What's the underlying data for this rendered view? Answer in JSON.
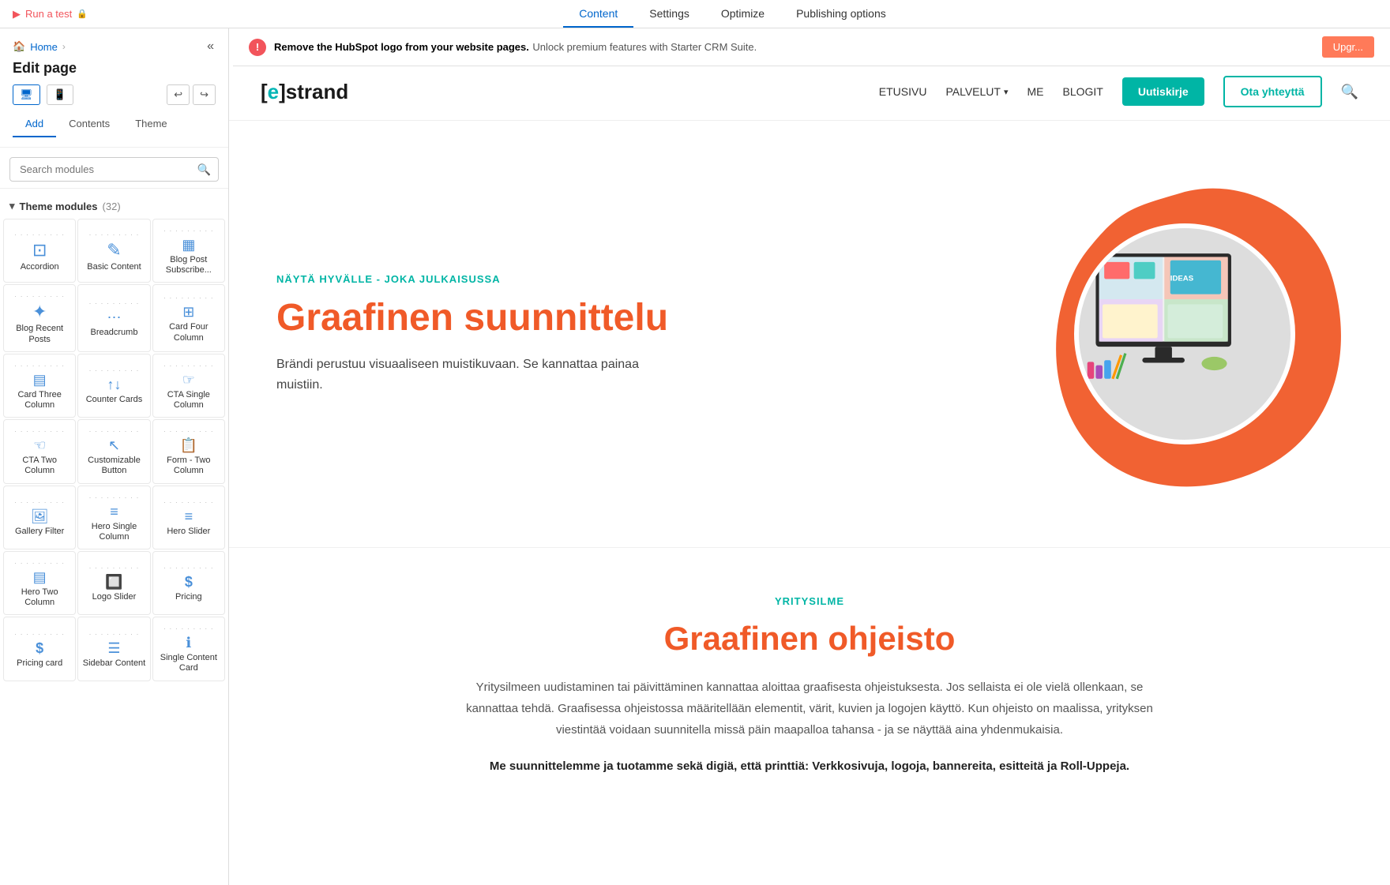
{
  "topBar": {
    "runTest": "Run a test",
    "tabs": [
      "Content",
      "Settings",
      "Optimize",
      "Publishing options"
    ],
    "activeTab": "Content"
  },
  "notification": {
    "text": "Remove the HubSpot logo from your website pages.",
    "subtext": "Unlock premium features with Starter CRM Suite.",
    "upgradeLabel": "Upgr..."
  },
  "leftPanel": {
    "collapseIcon": "«",
    "breadcrumb": "Home",
    "pageTitle": "Edit page",
    "deviceIcons": [
      "desktop",
      "mobile"
    ],
    "undoRedo": [
      "undo",
      "redo"
    ],
    "tabs": [
      "Add",
      "Contents",
      "Theme"
    ],
    "activeTab": "Add",
    "search": {
      "placeholder": "Search modules",
      "icon": "🔍"
    },
    "themeBadge": "Theme",
    "sectionLabel": "Theme modules",
    "moduleCount": "32",
    "modules": [
      {
        "name": "Accordion",
        "icon": "⊡",
        "dots": "........."
      },
      {
        "name": "Basic Content",
        "icon": "✎",
        "dots": "........."
      },
      {
        "name": "Blog Post Subscribe...",
        "icon": "▦",
        "dots": "........."
      },
      {
        "name": "Blog Recent Posts",
        "icon": "✦",
        "dots": "........."
      },
      {
        "name": "Breadcrumb",
        "icon": "↑↓",
        "dots": "........."
      },
      {
        "name": "Card Four Column",
        "icon": "⊞",
        "dots": "........."
      },
      {
        "name": "Card Three Column",
        "icon": "⊟",
        "dots": "........."
      },
      {
        "name": "Counter Cards",
        "icon": "↑↓",
        "dots": "........."
      },
      {
        "name": "CTA Single Column",
        "icon": "☞",
        "dots": "........."
      },
      {
        "name": "CTA Two Column",
        "icon": "☜",
        "dots": "........."
      },
      {
        "name": "Customizable Button",
        "icon": "↖",
        "dots": "........."
      },
      {
        "name": "Form - Two Column",
        "icon": "📋",
        "dots": "........."
      },
      {
        "name": "Gallery Filter",
        "icon": "🖼",
        "dots": "........."
      },
      {
        "name": "Hero Single Column",
        "icon": "≡",
        "dots": "........."
      },
      {
        "name": "Hero Slider",
        "icon": "≡≡",
        "dots": "........."
      },
      {
        "name": "Hero Two Column",
        "icon": "▤",
        "dots": "........."
      },
      {
        "name": "Logo Slider",
        "icon": "🔲",
        "dots": "........."
      },
      {
        "name": "Pricing",
        "icon": "$",
        "dots": "........."
      },
      {
        "name": "Pricing card",
        "icon": "$",
        "dots": "........."
      },
      {
        "name": "Sidebar Content",
        "icon": "☰",
        "dots": "........."
      },
      {
        "name": "Single Content Card",
        "icon": "ℹ",
        "dots": "........."
      }
    ]
  },
  "site": {
    "logoText": "[e]strand",
    "nav": [
      "ETUSIVU",
      "PALVELUT",
      "ME",
      "BLOGIT"
    ],
    "ctaButtons": [
      "Uutiskirje",
      "Ota yhteyttä"
    ],
    "hero": {
      "eyebrow": "NÄYTÄ HYVÄLLE - JOKA JULKAISUSSA",
      "title": "Graafinen suunnittelu",
      "body": "Brändi perustuu visuaaliseen muistikuvaan. Se kannattaa painaa muistiin."
    },
    "section2": {
      "eyebrow": "Yritysilme",
      "title": "Graafinen ohjeisto",
      "body": "Yritysilmeen uudistaminen tai päivittäminen kannattaa aloittaa graafisesta ohjeistuksesta. Jos sellaista ei ole vielä ollenkaan, se kannattaa tehdä. Graafisessa ohjeistossa määritellään elementit, värit, kuvien ja logojen käyttö. Kun ohjeisto on maalissa, yrityksen viestintää voidaan suunnitella missä päin maapalloa tahansa - ja se näyttää aina yhdenmukaisia.",
      "bodyBold": "Me suunnittelemme ja tuotamme sekä digiä, että printtiä: Verkkosivuja, logoja, bannereita, esitteitä ja Roll-Uppeja."
    }
  },
  "colors": {
    "teal": "#00b5a5",
    "orange": "#f05a28",
    "blobOrange": "#f05a28",
    "accent": "#4a90d9"
  }
}
